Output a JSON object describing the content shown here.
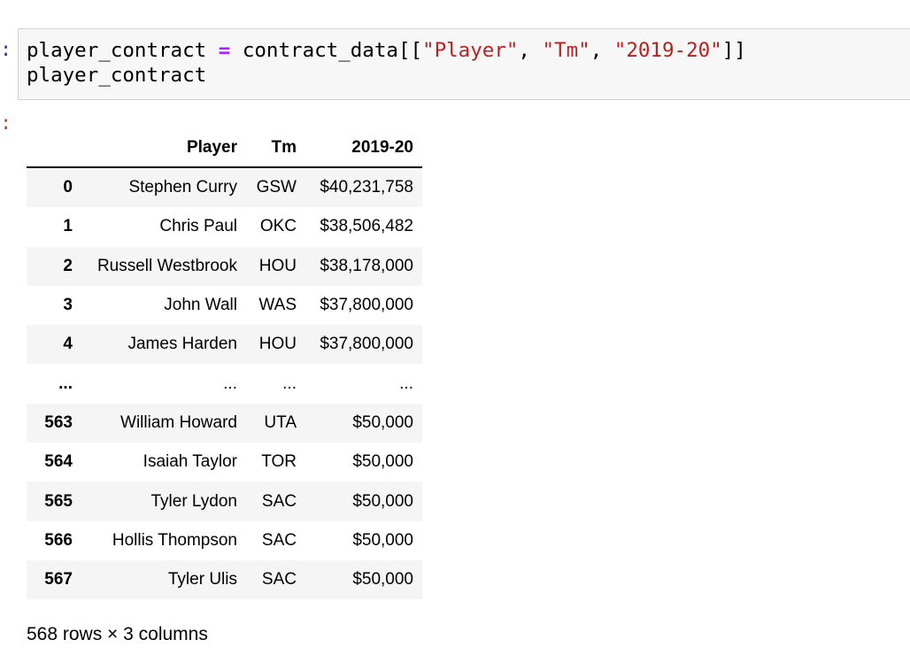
{
  "cell": {
    "in_prompt": ":",
    "out_prompt": ":",
    "code": {
      "line1": {
        "var": "player_contract ",
        "op": "=",
        "rest_pre": " contract_data[[",
        "s1": "\"Player\"",
        "c1": ", ",
        "s2": "\"Tm\"",
        "c2": ", ",
        "s3": "\"2019-20\"",
        "rest_post": "]]"
      },
      "line2": "player_contract"
    }
  },
  "table": {
    "columns": [
      "Player",
      "Tm",
      "2019-20"
    ],
    "rows": [
      {
        "index": "0",
        "player": "Stephen Curry",
        "tm": "GSW",
        "salary": "$40,231,758"
      },
      {
        "index": "1",
        "player": "Chris Paul",
        "tm": "OKC",
        "salary": "$38,506,482"
      },
      {
        "index": "2",
        "player": "Russell Westbrook",
        "tm": "HOU",
        "salary": "$38,178,000"
      },
      {
        "index": "3",
        "player": "John Wall",
        "tm": "WAS",
        "salary": "$37,800,000"
      },
      {
        "index": "4",
        "player": "James Harden",
        "tm": "HOU",
        "salary": "$37,800,000"
      },
      {
        "index": "...",
        "player": "...",
        "tm": "...",
        "salary": "..."
      },
      {
        "index": "563",
        "player": "William Howard",
        "tm": "UTA",
        "salary": "$50,000"
      },
      {
        "index": "564",
        "player": "Isaiah Taylor",
        "tm": "TOR",
        "salary": "$50,000"
      },
      {
        "index": "565",
        "player": "Tyler Lydon",
        "tm": "SAC",
        "salary": "$50,000"
      },
      {
        "index": "566",
        "player": "Hollis Thompson",
        "tm": "SAC",
        "salary": "$50,000"
      },
      {
        "index": "567",
        "player": "Tyler Ulis",
        "tm": "SAC",
        "salary": "$50,000"
      }
    ]
  },
  "shape_note": "568 rows × 3 columns",
  "colors": {
    "in_prompt": "#303F9F",
    "out_prompt": "#D84315",
    "string": "#BA2121",
    "operator": "#AA22FF",
    "cell_bg": "#f7f7f7",
    "stripe": "#f5f5f5"
  }
}
